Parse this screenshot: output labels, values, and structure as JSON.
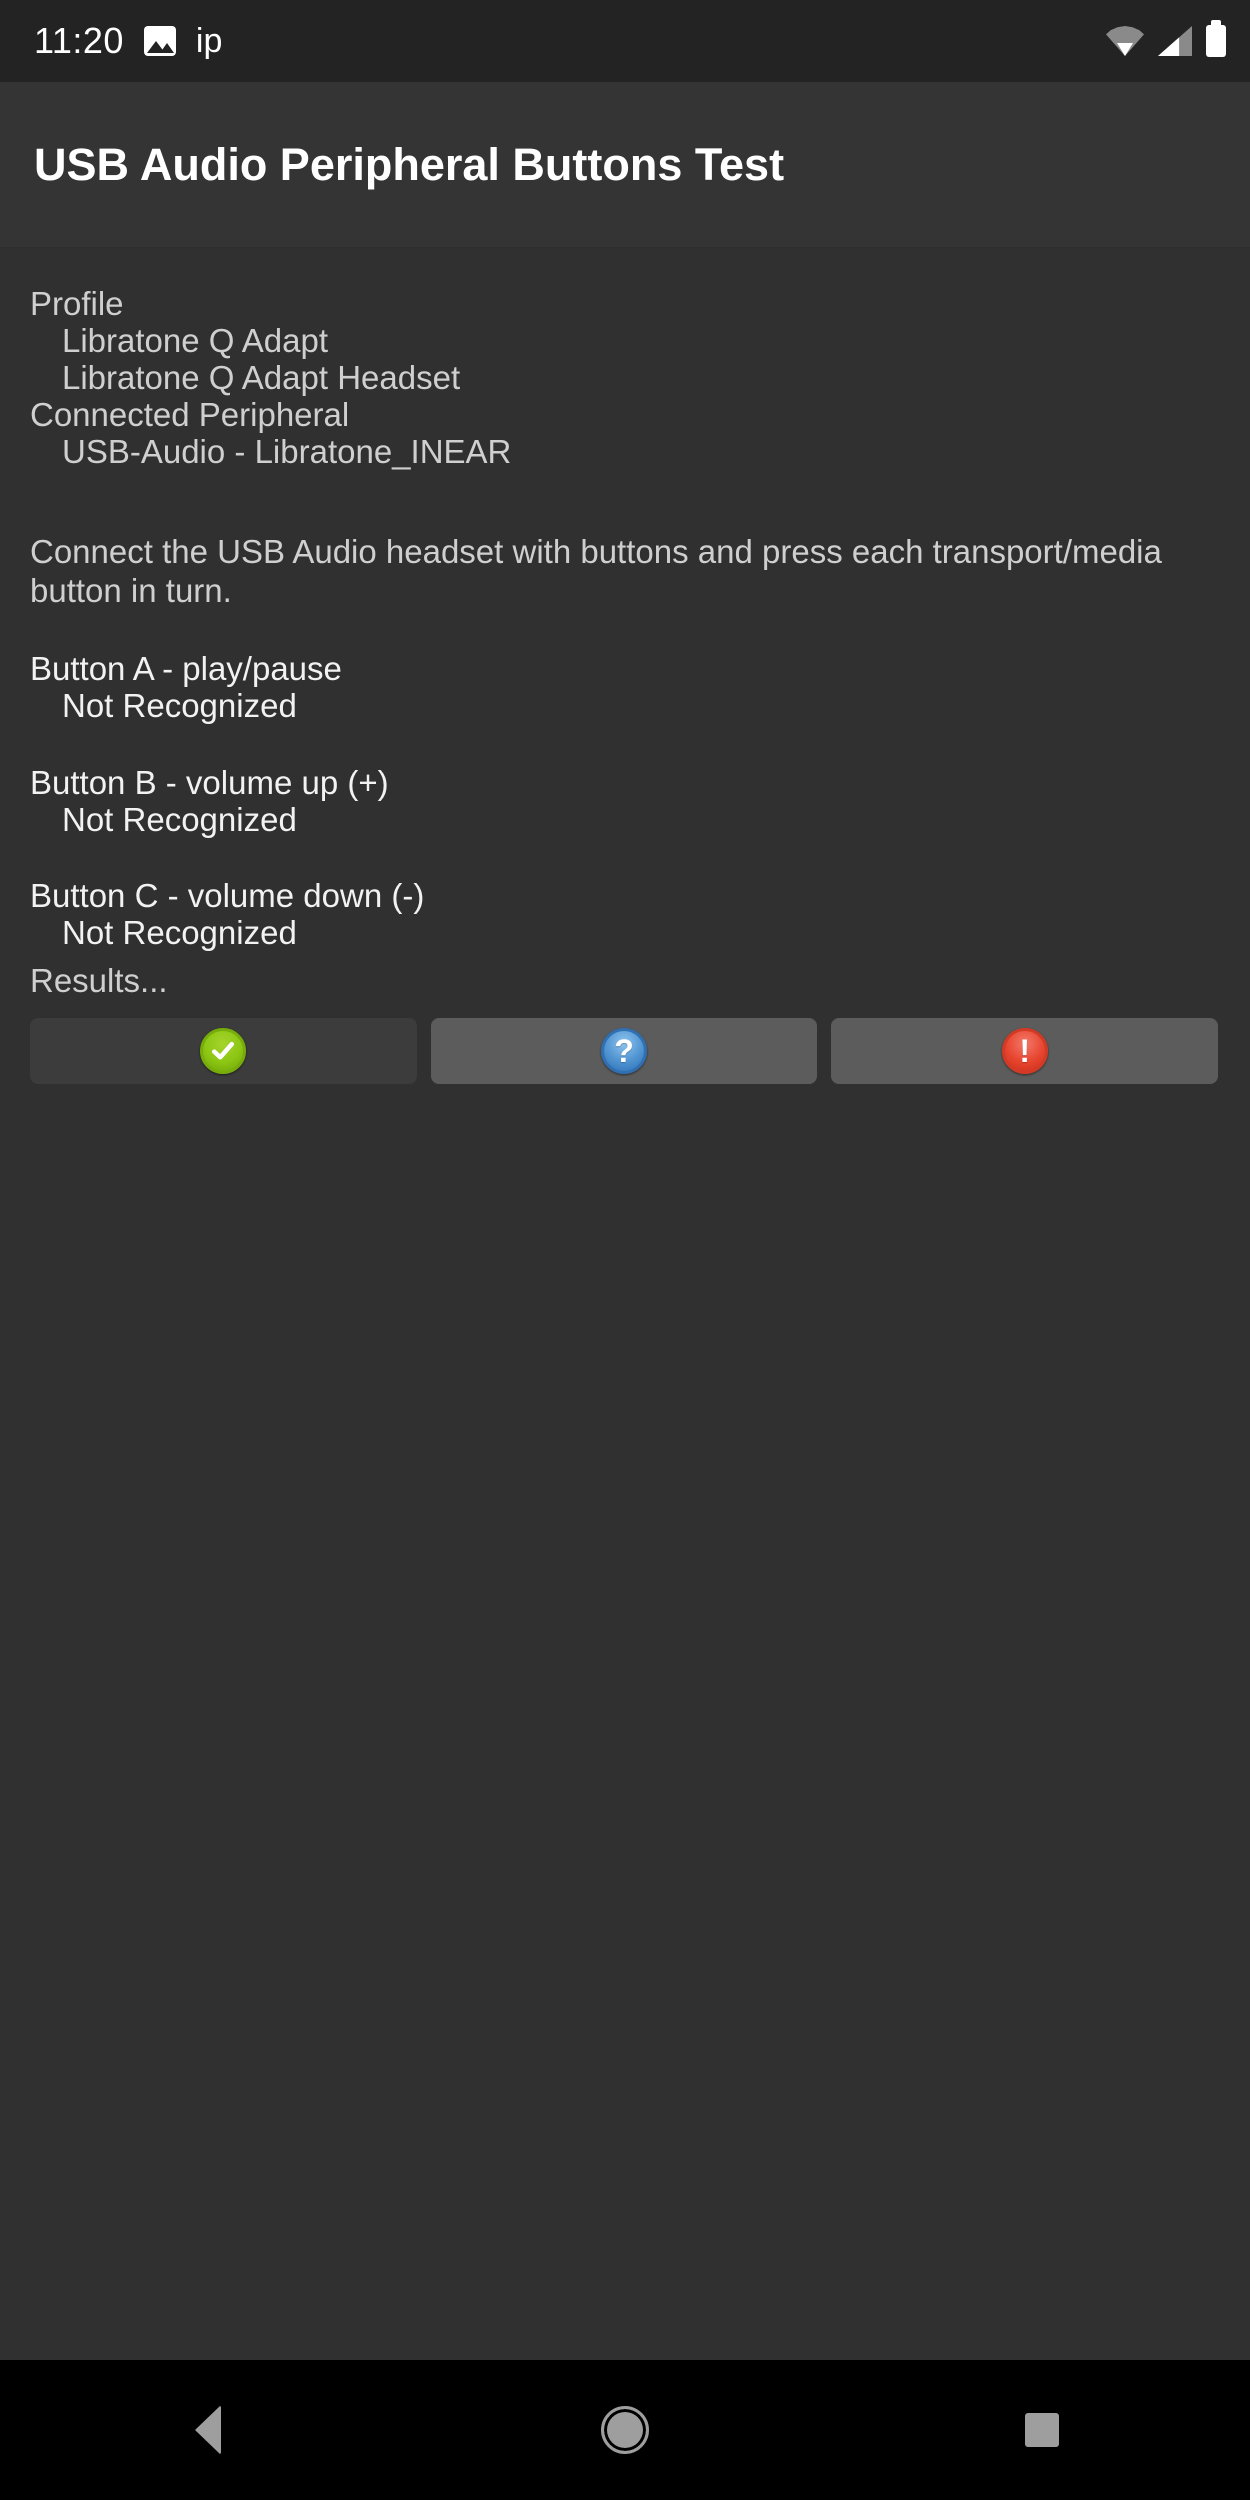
{
  "status_bar": {
    "clock": "11:20",
    "notification_label": "ip",
    "icons": [
      "image-icon",
      "wifi-icon",
      "signal-icon",
      "battery-icon"
    ]
  },
  "header": {
    "title": "USB Audio Peripheral Buttons Test"
  },
  "main": {
    "profile_label": "Profile",
    "profile_name": "Libratone Q Adapt",
    "profile_variant": "Libratone Q Adapt Headset",
    "connected_label": "Connected Peripheral",
    "connected_device": "USB-Audio - Libratone_INEAR",
    "instructions": "Connect the USB Audio headset with buttons and press each transport/media button in turn.",
    "buttons": [
      {
        "label": "Button A - play/pause",
        "status": "Not Recognized"
      },
      {
        "label": "Button B - volume up (+)",
        "status": "Not Recognized"
      },
      {
        "label": "Button C - volume down (-)",
        "status": "Not Recognized"
      }
    ],
    "results_label": "Results..."
  },
  "result_buttons": [
    {
      "name": "pass-button",
      "icon": "check-circle-icon",
      "glyph": "✔",
      "state": "inactive",
      "color": "#8cc613"
    },
    {
      "name": "info-button",
      "icon": "question-circle-icon",
      "glyph": "?",
      "state": "active",
      "color": "#4f93d1"
    },
    {
      "name": "fail-button",
      "icon": "exclamation-circle-icon",
      "glyph": "!",
      "state": "active",
      "color": "#e8452f"
    }
  ],
  "nav_bar": {
    "back": "back-button",
    "home": "home-button",
    "recents": "recents-button"
  }
}
